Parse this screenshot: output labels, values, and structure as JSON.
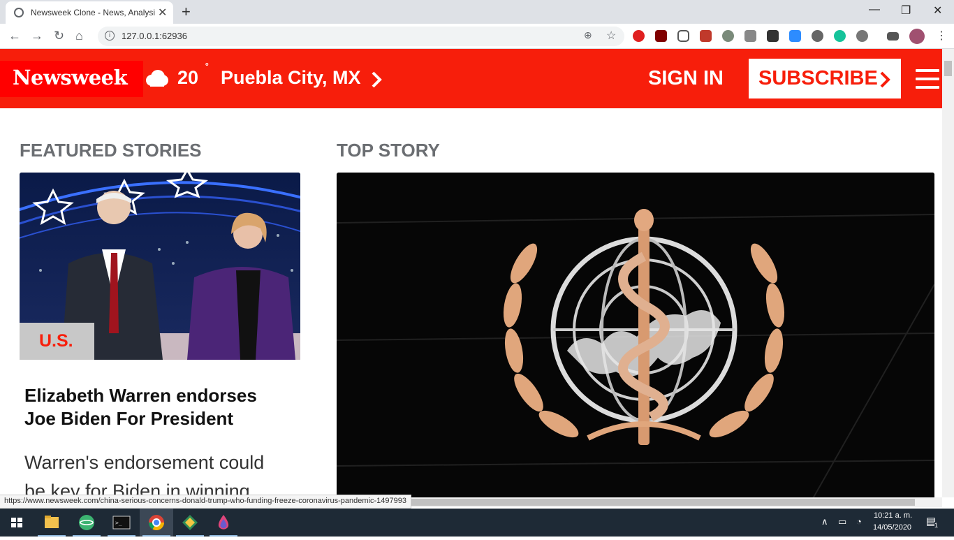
{
  "browser": {
    "tab_title": "Newsweek Clone - News, Analysis",
    "url": "127.0.0.1:62936",
    "status_url": "https://www.newsweek.com/china-serious-concerns-donald-trump-who-funding-freeze-coronavirus-pandemic-1497993"
  },
  "header": {
    "logo": "Newsweek",
    "temperature": "20",
    "degree_symbol": "˚",
    "city": "Puebla City, MX",
    "sign_in": "SIGN IN",
    "subscribe": "SUBSCRIBE",
    "colors": {
      "brand_red": "#f71e0b",
      "logo_red": "#ff0000"
    }
  },
  "featured": {
    "section_title": "FEATURED STORIES",
    "tag": "U.S.",
    "headline": "Elizabeth Warren endorses Joe Biden For President",
    "description": "Warren's endorsement could be key for Biden in winning"
  },
  "top_story": {
    "section_title": "TOP STORY",
    "image_alt": "World Health Organization emblem"
  },
  "taskbar": {
    "time": "10:21 a. m.",
    "date": "14/05/2020",
    "notification_count": "1"
  }
}
